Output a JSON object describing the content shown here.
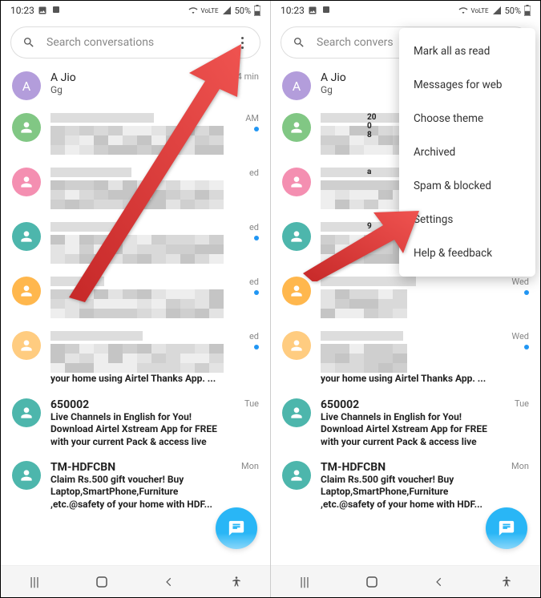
{
  "status": {
    "time": "10:23",
    "battery": "50%",
    "signal": "VoLTE"
  },
  "search": {
    "placeholder": "Search conversations"
  },
  "menu": {
    "items": [
      "Mark all as read",
      "Messages for web",
      "Choose theme",
      "Archived",
      "Spam & blocked",
      "Settings",
      "Help & feedback"
    ]
  },
  "conversations": [
    {
      "avatar_letter": "A",
      "avatar_color": "#b39ddb",
      "title": "A Jio",
      "preview": "Gg",
      "time": "24 min",
      "unread": false,
      "bold": false,
      "pixelated": false
    },
    {
      "avatar_letter": "",
      "avatar_color": "#81c784",
      "title": "",
      "preview": "",
      "time": "AM",
      "unread": true,
      "bold": true,
      "pixelated": true
    },
    {
      "avatar_letter": "",
      "avatar_color": "#f48fb1",
      "title": "",
      "preview": "",
      "time": "ed",
      "unread": false,
      "bold": false,
      "pixelated": true
    },
    {
      "avatar_letter": "",
      "avatar_color": "#4db6ac",
      "title": "",
      "preview": "",
      "time": "ed",
      "unread": true,
      "bold": true,
      "pixelated": true
    },
    {
      "avatar_letter": "",
      "avatar_color": "#ffb74d",
      "title": "",
      "preview": "",
      "time": "ed",
      "unread": true,
      "bold": true,
      "pixelated": true
    },
    {
      "avatar_letter": "",
      "avatar_color": "#ffcc80",
      "title": "",
      "preview": "your home using Airtel Thanks App. ...",
      "time": "ed",
      "unread": true,
      "bold": true,
      "pixelated": true
    },
    {
      "avatar_letter": "",
      "avatar_color": "#4db6ac",
      "title": "650002",
      "preview": "Live Channels in English for You! Download Airtel Xstream App for FREE with your current Pack & access live ...",
      "time": "Tue",
      "unread": false,
      "bold": true,
      "pixelated": false
    },
    {
      "avatar_letter": "",
      "avatar_color": "#4db6ac",
      "title": "TM-HDFCBN",
      "preview": "Claim Rs.500 gift voucher! Buy Laptop,SmartPhone,Furniture ,etc.@safety of your home with HDF...",
      "time": "Mon",
      "unread": false,
      "bold": true,
      "pixelated": false
    }
  ],
  "conversations_right_times": [
    "",
    "",
    "",
    "",
    "Wed",
    "Wed",
    "Tue",
    "Mon"
  ],
  "conversations_right_preview_snippets": [
    "",
    "20\n0\n8",
    "a",
    "9",
    "",
    "",
    "",
    ""
  ],
  "colors": {
    "accent": "#29b6f6",
    "arrow": "#e53935"
  }
}
